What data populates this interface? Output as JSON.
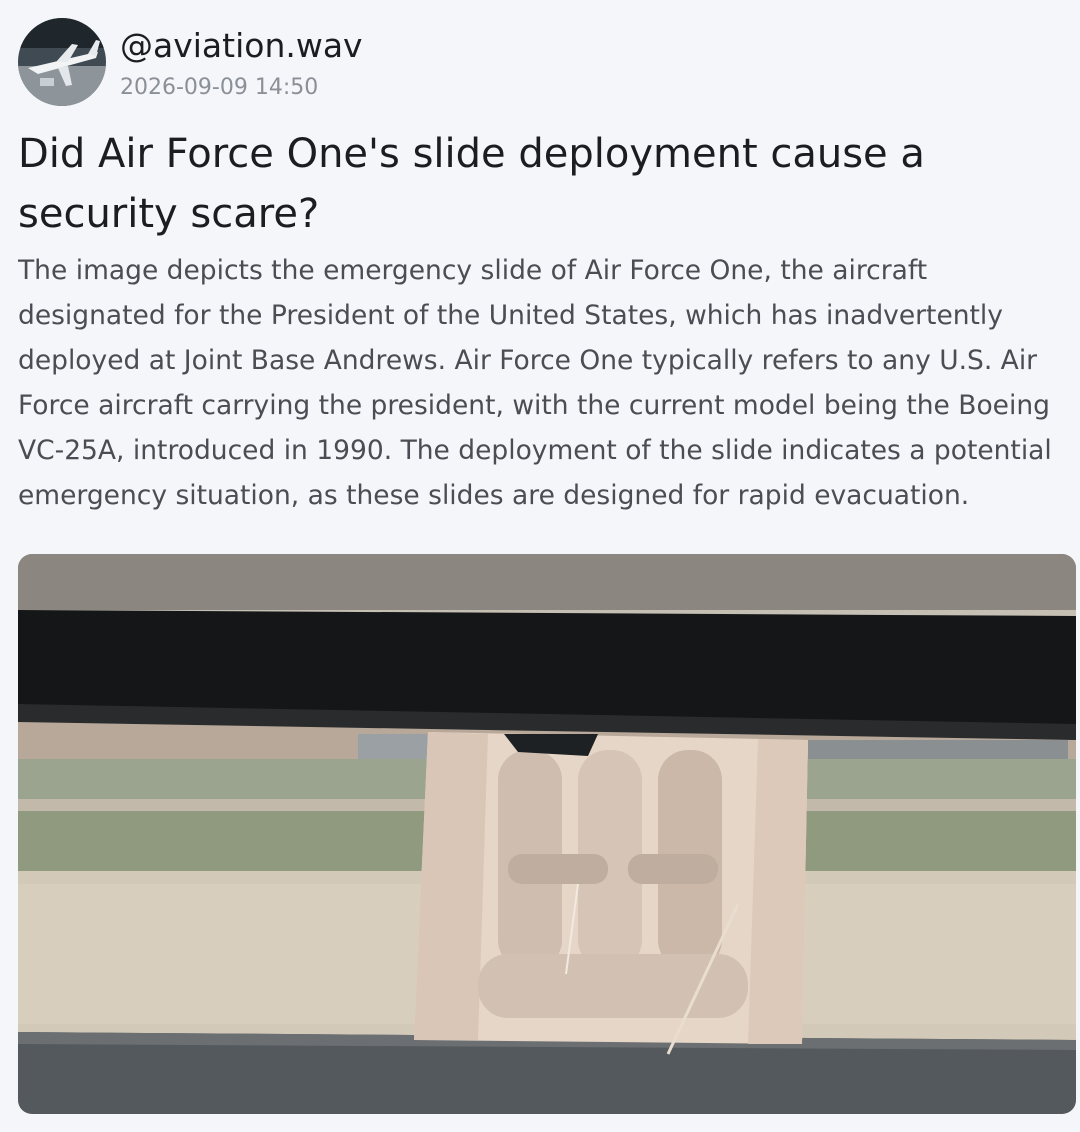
{
  "post": {
    "username": "@aviation.wav",
    "timestamp": "2026-09-09 14:50",
    "title": "Did Air Force One's slide deployment cause a security scare?",
    "body": "The image depicts the emergency slide of Air Force One, the aircraft designated for the President of the United States, which has inadvertently deployed at Joint Base Andrews. Air Force One typically refers to any U.S. Air Force aircraft carrying the president, with the current model being the Boeing VC-25A, introduced in 1990. The deployment of the slide indicates a potential emergency situation, as these slides are designed for rapid evacuation.",
    "avatar_icon": "airplane-avatar-icon",
    "image_icon": "emergency-slide-photo"
  },
  "colors": {
    "background": "#f5f6f9",
    "username": "#1c1d20",
    "timestamp": "#8a8f98",
    "body_text": "#4a4d53"
  }
}
